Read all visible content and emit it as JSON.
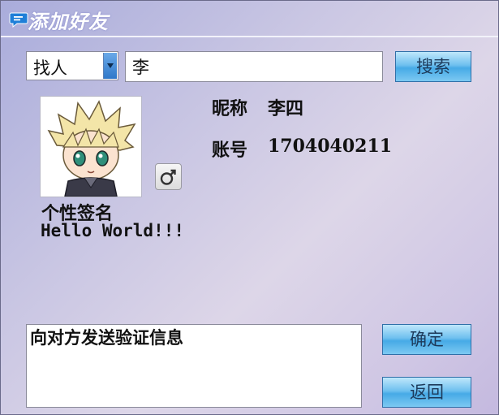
{
  "window": {
    "title": "添加好友",
    "icon": "chat-bubble-icon"
  },
  "search": {
    "type_selected": "找人",
    "query": "李",
    "button_label": "搜索"
  },
  "profile": {
    "avatar_icon": "avatar-icon",
    "gender_icon": "male-icon",
    "nickname_label": "昵称",
    "nickname": "李四",
    "account_label": "账号",
    "account": "1704040211",
    "signature_label": "个性签名",
    "signature": "Hello World!!!"
  },
  "verification": {
    "text": "向对方发送验证信息"
  },
  "actions": {
    "confirm_label": "确定",
    "back_label": "返回"
  },
  "colors": {
    "accent": "#46aae6",
    "title_line": "#f2f2fa"
  }
}
